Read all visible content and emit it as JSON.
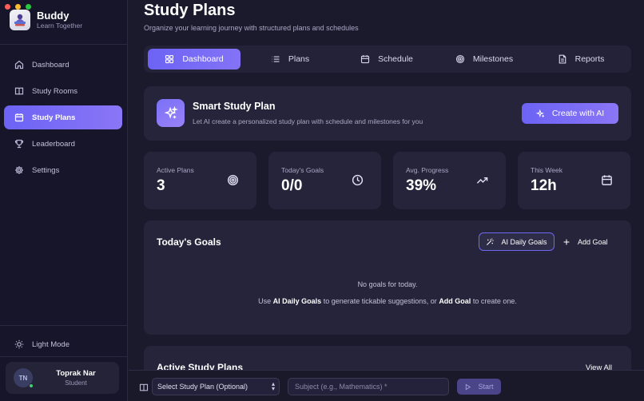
{
  "colors": {
    "background": "#1b1a2c",
    "sidebar": "#16152a",
    "card": "#25243a",
    "accent": "#6c63f5",
    "accent_light": "#8a76f6",
    "traffic_red": "#fe5f57",
    "traffic_yellow": "#febc2e",
    "traffic_green": "#28c840",
    "online": "#3ecf6e"
  },
  "brand": {
    "name": "Buddy",
    "tagline": "Learn Together",
    "logo_icon": "buddy-logo-icon"
  },
  "sidebar": {
    "items": [
      {
        "label": "Dashboard",
        "icon": "home-icon",
        "active": false
      },
      {
        "label": "Study Rooms",
        "icon": "book-icon",
        "active": false
      },
      {
        "label": "Study Plans",
        "icon": "calendar-icon",
        "active": true
      },
      {
        "label": "Leaderboard",
        "icon": "trophy-icon",
        "active": false
      },
      {
        "label": "Settings",
        "icon": "gear-icon",
        "active": false
      }
    ],
    "theme_toggle": {
      "label": "Light Mode",
      "icon": "sun-icon"
    }
  },
  "user": {
    "initials": "TN",
    "name": "Toprak Nar",
    "role": "Student",
    "status": "online"
  },
  "header": {
    "title": "Study Plans",
    "subtitle": "Organize your learning journey with structured plans and schedules"
  },
  "tabs": [
    {
      "label": "Dashboard",
      "icon": "grid-icon",
      "active": true
    },
    {
      "label": "Plans",
      "icon": "list-icon",
      "active": false
    },
    {
      "label": "Schedule",
      "icon": "calendar-icon",
      "active": false
    },
    {
      "label": "Milestones",
      "icon": "target-icon",
      "active": false
    },
    {
      "label": "Reports",
      "icon": "document-icon",
      "active": false
    }
  ],
  "smart_plan": {
    "title": "Smart Study Plan",
    "description": "Let AI create a personalized study plan with schedule and milestones for you",
    "button_label": "Create with AI",
    "icon": "sparkles-icon"
  },
  "stats": [
    {
      "label": "Active Plans",
      "value": "3",
      "icon": "target-icon"
    },
    {
      "label": "Today's Goals",
      "value": "0/0",
      "icon": "clock-icon"
    },
    {
      "label": "Avg. Progress",
      "value": "39%",
      "icon": "trending-up-icon"
    },
    {
      "label": "This Week",
      "value": "12h",
      "icon": "calendar-icon"
    }
  ],
  "todays_goals": {
    "title": "Today's Goals",
    "ai_button_label": "AI Daily Goals",
    "add_button_label": "Add Goal",
    "empty_message": "No goals for today.",
    "hint_prefix": "Use",
    "hint_ai": "AI Daily Goals",
    "hint_middle": "to generate tickable suggestions, or",
    "hint_add": "Add Goal",
    "hint_suffix": "to create one."
  },
  "active_plans": {
    "title": "Active Study Plans",
    "view_all_label": "View All"
  },
  "bottom_bar": {
    "plan_select_value": "Select Study Plan (Optional)",
    "subject_placeholder": "Subject (e.g., Mathematics) *",
    "start_label": "Start"
  }
}
